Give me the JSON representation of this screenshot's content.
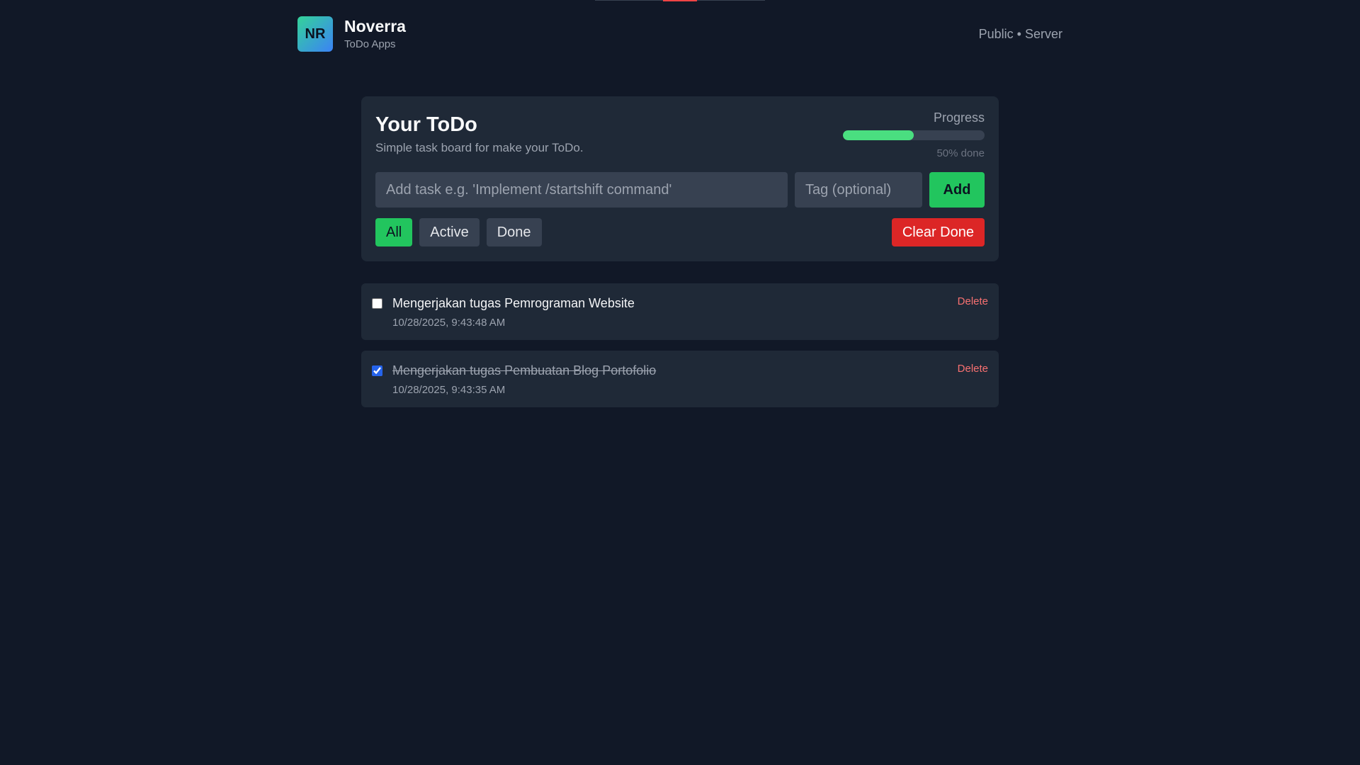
{
  "header": {
    "logo_text": "NR",
    "brand_name": "Noverra",
    "brand_sub": "ToDo Apps",
    "meta": "Public • Server"
  },
  "board": {
    "title": "Your ToDo",
    "subtitle": "Simple task board for make your ToDo.",
    "progress_label": "Progress",
    "progress_percent": 50,
    "progress_text": "50% done",
    "task_placeholder": "Add task e.g. 'Implement /startshift command'",
    "task_value": "",
    "tag_placeholder": "Tag (optional)",
    "tag_value": "",
    "add_label": "Add",
    "filters": {
      "all": "All",
      "active": "Active",
      "done": "Done",
      "selected": "All"
    },
    "clear_done_label": "Clear Done"
  },
  "tasks": [
    {
      "text": "Mengerjakan tugas Pemrograman Website",
      "time": "10/28/2025, 9:43:48 AM",
      "done": false,
      "delete_label": "Delete"
    },
    {
      "text": "Mengerjakan tugas Pembuatan Blog Portofolio",
      "time": "10/28/2025, 9:43:35 AM",
      "done": true,
      "delete_label": "Delete"
    }
  ],
  "colors": {
    "background": "#111827",
    "card": "#1f2937",
    "accent_green": "#22c55e",
    "danger_red": "#dc2626",
    "progress_fill": "#4ade80"
  }
}
